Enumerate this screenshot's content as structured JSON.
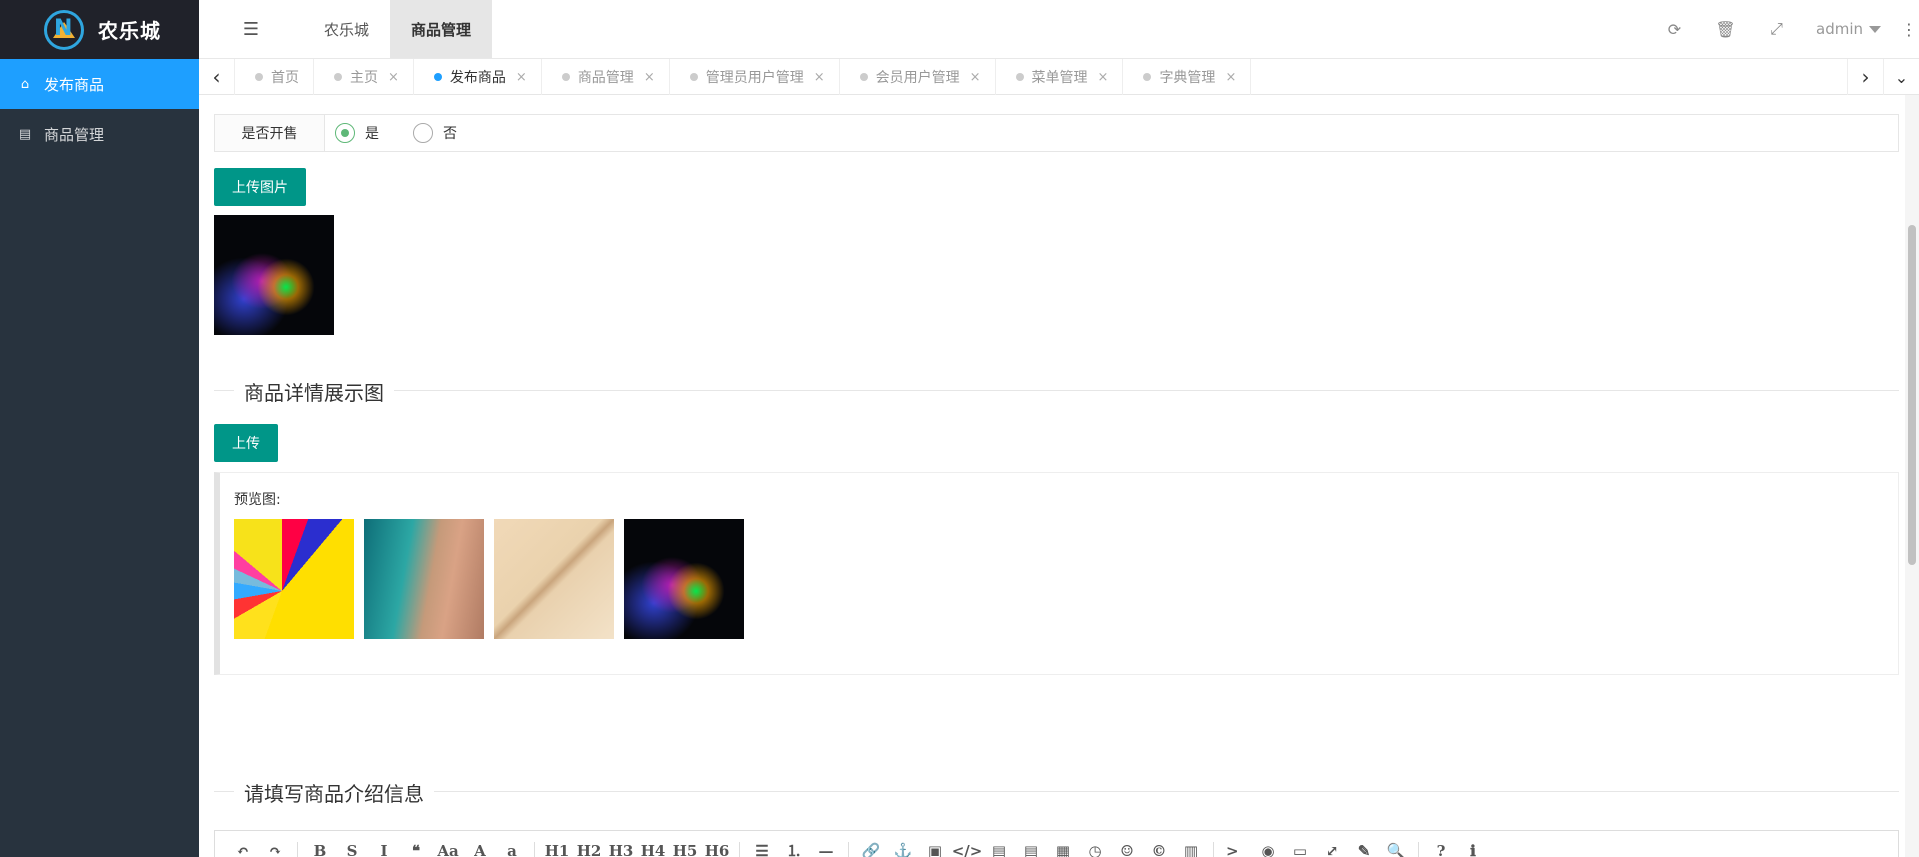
{
  "brand": {
    "name": "农乐城"
  },
  "sidebar": {
    "items": [
      {
        "label": "发布商品",
        "icon": "home-icon"
      },
      {
        "label": "商品管理",
        "icon": "document-icon"
      }
    ]
  },
  "header": {
    "tabs": [
      {
        "label": "农乐城"
      },
      {
        "label": "商品管理"
      }
    ],
    "user": "admin"
  },
  "tabbar": {
    "tabs": [
      {
        "label": "首页"
      },
      {
        "label": "主页"
      },
      {
        "label": "发布商品"
      },
      {
        "label": "商品管理"
      },
      {
        "label": "管理员用户管理"
      },
      {
        "label": "会员用户管理"
      },
      {
        "label": "菜单管理"
      },
      {
        "label": "字典管理"
      }
    ],
    "close_glyph": "×"
  },
  "form": {
    "sale_label": "是否开售",
    "sale_options": [
      {
        "label": "是",
        "checked": true
      },
      {
        "label": "否",
        "checked": false
      }
    ],
    "upload_image_label": "上传图片",
    "detail_section_title": "商品详情展示图",
    "upload_label": "上传",
    "preview_label": "预览图:",
    "intro_section_title": "请填写商品介绍信息"
  },
  "editor": {
    "tools": [
      "↶",
      "↷",
      "|",
      "B",
      "S",
      "I",
      "❝",
      "Aa",
      "A",
      "a",
      "|",
      "H1",
      "H2",
      "H3",
      "H4",
      "H5",
      "H6",
      "|",
      "☰",
      "⒈",
      "—",
      "|",
      "🔗",
      "⚓",
      "▣",
      "</>",
      "▤",
      "▤",
      "▦",
      "◷",
      "☺",
      "©",
      "▥",
      "|",
      ">_",
      "◉",
      "▭",
      "⤢",
      "✎",
      "🔍",
      "|",
      "?",
      "ℹ"
    ]
  },
  "colors": {
    "accent": "#1e9fff",
    "button": "#009688",
    "sidebar": "#28333e"
  }
}
